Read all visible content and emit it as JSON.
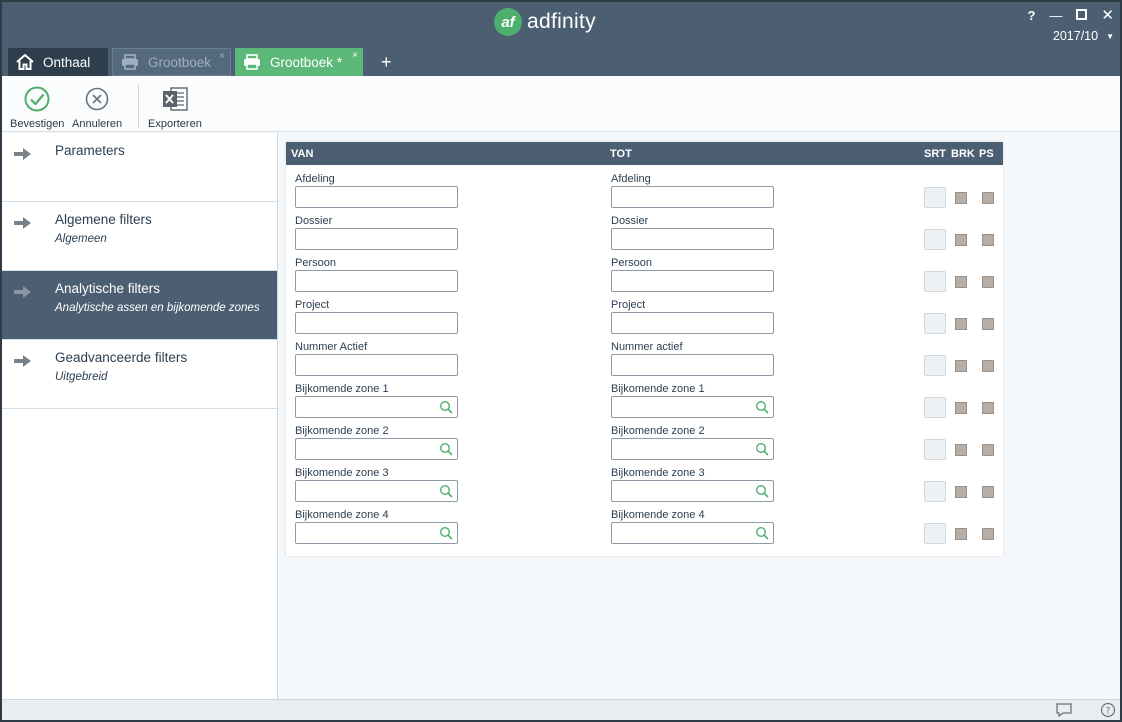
{
  "app": {
    "logo_mark": "af",
    "logo_text": "adfinity"
  },
  "window_controls": {
    "help": "?",
    "minimize": "—",
    "close": "✕"
  },
  "period": {
    "value": "2017/10"
  },
  "tabs": [
    {
      "label": "Onthaal",
      "icon": "home-icon",
      "state": "home"
    },
    {
      "label": "Grootboek",
      "icon": "printer-icon",
      "state": "inactive",
      "close": "×"
    },
    {
      "label": "Grootboek *",
      "icon": "printer-icon",
      "state": "active",
      "close": "×"
    }
  ],
  "tab_add": "+",
  "toolbar": {
    "confirm_label": "Bevestigen",
    "cancel_label": "Annuleren",
    "export_label": "Exporteren"
  },
  "sidebar": {
    "items": [
      {
        "title": "Parameters",
        "subtitle": ""
      },
      {
        "title": "Algemene filters",
        "subtitle": "Algemeen"
      },
      {
        "title": "Analytische filters",
        "subtitle": "Analytische assen en bijkomende zones"
      },
      {
        "title": "Geadvanceerde filters",
        "subtitle": "Uitgebreid"
      }
    ],
    "active_index": 2
  },
  "panel": {
    "headers": {
      "van": "VAN",
      "tot": "TOT",
      "srt": "SRT",
      "brk": "BRK",
      "ps": "PS"
    },
    "rows": [
      {
        "van_label": "Afdeling",
        "tot_label": "Afdeling",
        "search": false
      },
      {
        "van_label": "Dossier",
        "tot_label": "Dossier",
        "search": false
      },
      {
        "van_label": "Persoon",
        "tot_label": "Persoon",
        "search": false
      },
      {
        "van_label": "Project",
        "tot_label": "Project",
        "search": false
      },
      {
        "van_label": "Nummer Actief",
        "tot_label": "Nummer actief",
        "search": false
      },
      {
        "van_label": "Bijkomende zone 1",
        "tot_label": "Bijkomende zone 1",
        "search": true
      },
      {
        "van_label": "Bijkomende zone 2",
        "tot_label": "Bijkomende zone 2",
        "search": true
      },
      {
        "van_label": "Bijkomende zone 3",
        "tot_label": "Bijkomende zone 3",
        "search": true
      },
      {
        "van_label": "Bijkomende zone 4",
        "tot_label": "Bijkomende zone 4",
        "search": true
      }
    ]
  },
  "colors": {
    "header_bg": "#4c5f72",
    "accent_green": "#5cb878",
    "logo_green": "#4caf6e"
  }
}
